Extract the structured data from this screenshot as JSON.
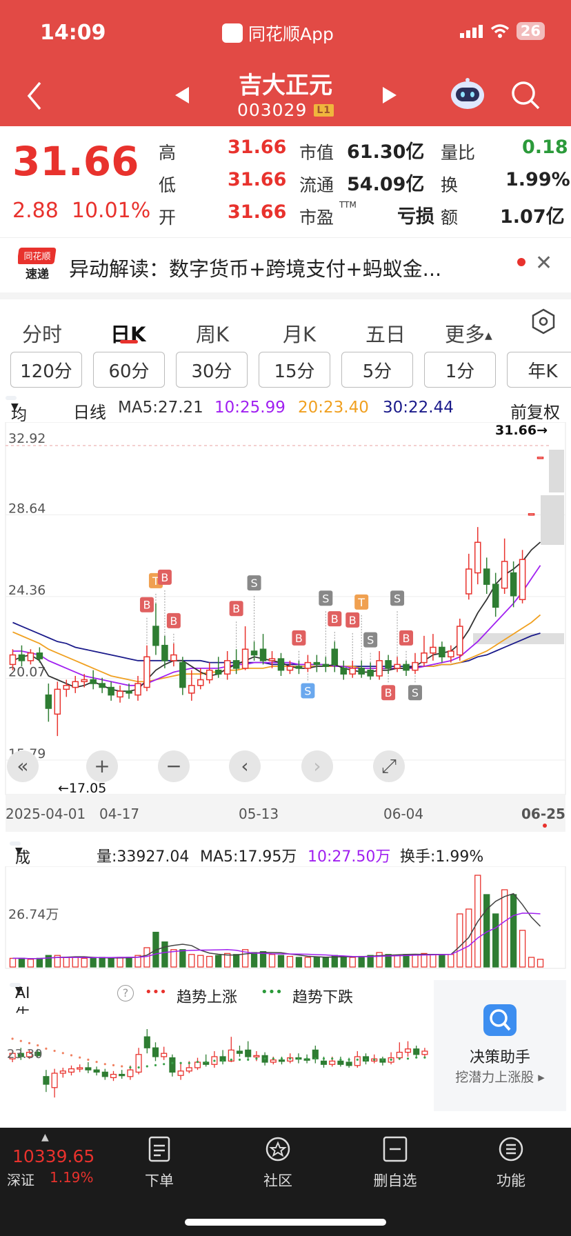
{
  "status": {
    "time": "14:09",
    "app_name": "同花顺App",
    "battery": "26"
  },
  "stock": {
    "name": "吉大正元",
    "code": "003029",
    "tag": "L1"
  },
  "quote": {
    "price": "31.66",
    "change": "2.88",
    "change_pct": "10.01%",
    "high_label": "高",
    "high": "31.66",
    "low_label": "低",
    "low": "31.66",
    "open_label": "开",
    "open": "31.66",
    "mcap_label": "市值",
    "mcap": "61.30亿",
    "float_label": "流通",
    "float": "54.09亿",
    "pe_label": "市盈",
    "pe_sup": "TTM",
    "pe": "亏损",
    "vr_label": "量比",
    "vr": "0.18",
    "turnover_label": "换",
    "turnover": "1.99%",
    "amount_label": "额",
    "amount": "1.07亿"
  },
  "alert": {
    "badge_top": "同花顺",
    "badge_bottom": "速递",
    "text": "异动解读：数字货币+跨境支付+蚂蚁金..."
  },
  "tabs": [
    "分时",
    "日K",
    "周K",
    "月K",
    "五日",
    "更多"
  ],
  "periods": [
    "120分",
    "60分",
    "30分",
    "15分",
    "5分",
    "1分",
    "年K"
  ],
  "ma": {
    "selector": "均线",
    "period": "日线",
    "ma5": "MA5:27.21",
    "ma10": "10:25.99",
    "ma20": "20:23.40",
    "ma30": "30:22.44",
    "adjust": "前复权"
  },
  "colors": {
    "up": "#e8322d",
    "down": "#2e7d32",
    "ma5": "#333333",
    "ma10": "#a020f0",
    "ma20": "#f0a020",
    "ma30": "#1a1a8a"
  },
  "chart_data": {
    "type": "candlestick",
    "y_ticks": [
      "32.92",
      "28.64",
      "24.36",
      "20.07",
      "15.79"
    ],
    "x_ticks": [
      "2025-04-01",
      "04-17",
      "05-13",
      "06-04",
      "06-25"
    ],
    "ylim": [
      15.79,
      32.92
    ],
    "last_price_label": "31.66→",
    "low_label": "←17.05",
    "candles": [
      {
        "o": 20.8,
        "c": 21.3,
        "h": 21.6,
        "l": 20.5
      },
      {
        "o": 21.3,
        "c": 21.0,
        "h": 21.8,
        "l": 20.7
      },
      {
        "o": 21.0,
        "c": 21.4,
        "h": 21.6,
        "l": 20.8
      },
      {
        "o": 21.4,
        "c": 21.1,
        "h": 21.7,
        "l": 20.9
      },
      {
        "o": 19.2,
        "c": 18.5,
        "h": 19.8,
        "l": 17.8
      },
      {
        "o": 18.2,
        "c": 19.5,
        "h": 19.9,
        "l": 17.05
      },
      {
        "o": 19.5,
        "c": 19.7,
        "h": 20.0,
        "l": 19.1
      },
      {
        "o": 19.6,
        "c": 19.9,
        "h": 20.2,
        "l": 19.3
      },
      {
        "o": 19.9,
        "c": 20.0,
        "h": 20.3,
        "l": 19.6
      },
      {
        "o": 20.0,
        "c": 19.8,
        "h": 20.5,
        "l": 19.5
      },
      {
        "o": 19.8,
        "c": 19.6,
        "h": 20.1,
        "l": 19.3
      },
      {
        "o": 19.6,
        "c": 19.2,
        "h": 19.9,
        "l": 18.9
      },
      {
        "o": 19.1,
        "c": 19.4,
        "h": 19.7,
        "l": 18.8
      },
      {
        "o": 19.4,
        "c": 19.3,
        "h": 19.8,
        "l": 19.0
      },
      {
        "o": 19.2,
        "c": 19.8,
        "h": 20.2,
        "l": 18.9
      },
      {
        "o": 19.6,
        "c": 21.2,
        "h": 21.8,
        "l": 19.4
      },
      {
        "o": 22.8,
        "c": 21.8,
        "h": 24.0,
        "l": 21.3
      },
      {
        "o": 21.8,
        "c": 21.0,
        "h": 22.3,
        "l": 20.6
      },
      {
        "o": 21.0,
        "c": 21.3,
        "h": 21.9,
        "l": 20.7
      },
      {
        "o": 20.9,
        "c": 19.6,
        "h": 21.2,
        "l": 19.2
      },
      {
        "o": 19.3,
        "c": 19.7,
        "h": 20.5,
        "l": 18.9
      },
      {
        "o": 19.7,
        "c": 20.0,
        "h": 20.6,
        "l": 19.5
      },
      {
        "o": 20.0,
        "c": 20.5,
        "h": 20.9,
        "l": 19.8
      },
      {
        "o": 20.5,
        "c": 20.3,
        "h": 21.2,
        "l": 20.1
      },
      {
        "o": 20.3,
        "c": 21.0,
        "h": 21.5,
        "l": 20.0
      },
      {
        "o": 21.0,
        "c": 20.6,
        "h": 21.6,
        "l": 20.3
      },
      {
        "o": 20.6,
        "c": 21.6,
        "h": 22.8,
        "l": 20.5
      },
      {
        "o": 21.5,
        "c": 21.3,
        "h": 22.0,
        "l": 21.0
      },
      {
        "o": 21.6,
        "c": 21.0,
        "h": 22.4,
        "l": 20.8
      },
      {
        "o": 21.0,
        "c": 21.1,
        "h": 21.5,
        "l": 20.6
      },
      {
        "o": 21.1,
        "c": 20.5,
        "h": 21.4,
        "l": 20.2
      },
      {
        "o": 20.5,
        "c": 20.7,
        "h": 21.0,
        "l": 20.3
      },
      {
        "o": 20.7,
        "c": 20.6,
        "h": 21.0,
        "l": 20.3
      },
      {
        "o": 20.6,
        "c": 20.9,
        "h": 21.3,
        "l": 20.4
      },
      {
        "o": 20.9,
        "c": 20.8,
        "h": 21.3,
        "l": 20.4
      },
      {
        "o": 20.8,
        "c": 20.7,
        "h": 21.2,
        "l": 20.4
      },
      {
        "o": 21.6,
        "c": 20.8,
        "h": 22.0,
        "l": 20.4
      },
      {
        "o": 20.6,
        "c": 20.3,
        "h": 21.0,
        "l": 20.0
      },
      {
        "o": 20.3,
        "c": 20.6,
        "h": 21.0,
        "l": 20.1
      },
      {
        "o": 20.6,
        "c": 20.3,
        "h": 21.0,
        "l": 20.1
      },
      {
        "o": 20.5,
        "c": 20.2,
        "h": 20.9,
        "l": 20.0
      },
      {
        "o": 20.2,
        "c": 21.0,
        "h": 21.5,
        "l": 20.0
      },
      {
        "o": 21.0,
        "c": 20.6,
        "h": 21.3,
        "l": 20.3
      },
      {
        "o": 20.6,
        "c": 20.8,
        "h": 21.2,
        "l": 20.4
      },
      {
        "o": 20.8,
        "c": 20.5,
        "h": 21.0,
        "l": 20.2
      },
      {
        "o": 20.5,
        "c": 20.9,
        "h": 21.4,
        "l": 20.3
      },
      {
        "o": 20.9,
        "c": 21.4,
        "h": 22.3,
        "l": 20.7
      },
      {
        "o": 21.4,
        "c": 21.7,
        "h": 22.4,
        "l": 21.0
      },
      {
        "o": 21.7,
        "c": 21.2,
        "h": 22.0,
        "l": 20.9
      },
      {
        "o": 21.2,
        "c": 21.5,
        "h": 21.8,
        "l": 20.9
      },
      {
        "o": 21.3,
        "c": 22.8,
        "h": 23.2,
        "l": 21.0
      },
      {
        "o": 24.5,
        "c": 25.8,
        "h": 26.6,
        "l": 24.2
      },
      {
        "o": 25.6,
        "c": 27.2,
        "h": 28.0,
        "l": 25.0
      },
      {
        "o": 25.8,
        "c": 25.0,
        "h": 26.4,
        "l": 24.5
      },
      {
        "o": 25.0,
        "c": 23.8,
        "h": 25.6,
        "l": 23.3
      },
      {
        "o": 24.8,
        "c": 26.2,
        "h": 27.4,
        "l": 24.5
      },
      {
        "o": 25.6,
        "c": 24.4,
        "h": 26.2,
        "l": 23.8
      },
      {
        "o": 24.2,
        "c": 26.3,
        "h": 26.8,
        "l": 24.0
      },
      {
        "o": 28.7,
        "c": 28.7,
        "h": 28.7,
        "l": 28.7
      },
      {
        "o": 31.66,
        "c": 31.66,
        "h": 31.66,
        "l": 31.66
      }
    ],
    "ma5": [
      21.0,
      21.2,
      21.3,
      21.0,
      20.2,
      20.0,
      19.8,
      19.6,
      19.7,
      19.9,
      19.7,
      19.5,
      19.4,
      19.4,
      19.5,
      20.0,
      20.5,
      20.8,
      21.0,
      21.0,
      20.7,
      20.4,
      20.2,
      20.3,
      20.6,
      20.8,
      21.0,
      21.2,
      21.1,
      21.0,
      20.9,
      20.7,
      20.6,
      20.6,
      20.7,
      20.7,
      20.8,
      20.6,
      20.5,
      20.4,
      20.4,
      20.5,
      20.5,
      20.6,
      20.6,
      20.7,
      21.0,
      21.3,
      21.4,
      21.5,
      21.9,
      22.6,
      23.5,
      24.2,
      25.0,
      25.5,
      25.8,
      26.2,
      26.8,
      27.21
    ],
    "ma10": [
      21.5,
      21.5,
      21.4,
      21.3,
      21.0,
      20.8,
      20.6,
      20.4,
      20.2,
      20.1,
      20.0,
      19.9,
      19.8,
      19.7,
      19.7,
      19.8,
      20.0,
      20.2,
      20.4,
      20.5,
      20.6,
      20.6,
      20.6,
      20.6,
      20.7,
      20.8,
      20.8,
      20.9,
      20.9,
      20.9,
      20.9,
      20.9,
      20.8,
      20.8,
      20.8,
      20.8,
      20.7,
      20.7,
      20.6,
      20.6,
      20.6,
      20.6,
      20.6,
      20.6,
      20.6,
      20.6,
      20.7,
      20.8,
      20.9,
      21.0,
      21.2,
      21.6,
      22.0,
      22.5,
      23.0,
      23.5,
      24.0,
      24.6,
      25.3,
      25.99
    ],
    "ma20": [
      22.5,
      22.3,
      22.1,
      21.9,
      21.6,
      21.4,
      21.2,
      21.0,
      20.8,
      20.6,
      20.4,
      20.2,
      20.1,
      20.0,
      19.9,
      19.9,
      20.0,
      20.1,
      20.2,
      20.3,
      20.3,
      20.3,
      20.4,
      20.4,
      20.5,
      20.5,
      20.6,
      20.6,
      20.6,
      20.7,
      20.7,
      20.7,
      20.7,
      20.7,
      20.7,
      20.7,
      20.7,
      20.7,
      20.7,
      20.6,
      20.6,
      20.6,
      20.6,
      20.6,
      20.6,
      20.6,
      20.7,
      20.7,
      20.8,
      20.8,
      20.9,
      21.1,
      21.3,
      21.5,
      21.8,
      22.1,
      22.4,
      22.7,
      23.0,
      23.4
    ],
    "ma30": [
      23.0,
      22.8,
      22.6,
      22.4,
      22.2,
      22.0,
      21.9,
      21.7,
      21.6,
      21.5,
      21.4,
      21.3,
      21.2,
      21.1,
      21.0,
      21.0,
      21.0,
      21.0,
      21.0,
      21.0,
      21.0,
      21.0,
      20.9,
      20.9,
      20.9,
      20.9,
      20.9,
      20.9,
      20.9,
      20.8,
      20.8,
      20.8,
      20.8,
      20.8,
      20.8,
      20.8,
      20.7,
      20.7,
      20.7,
      20.7,
      20.7,
      20.7,
      20.7,
      20.7,
      20.7,
      20.7,
      20.7,
      20.7,
      20.8,
      20.8,
      20.9,
      21.0,
      21.2,
      21.3,
      21.5,
      21.7,
      21.9,
      22.1,
      22.3,
      22.44
    ],
    "signals": [
      {
        "i": 16,
        "type": "T",
        "pos": "above"
      },
      {
        "i": 15,
        "type": "B",
        "pos": "above"
      },
      {
        "i": 17,
        "type": "B",
        "pos": "above"
      },
      {
        "i": 18,
        "type": "B",
        "pos": "above"
      },
      {
        "i": 25,
        "type": "B",
        "pos": "above"
      },
      {
        "i": 27,
        "type": "S",
        "pos": "above"
      },
      {
        "i": 32,
        "type": "B",
        "pos": "above"
      },
      {
        "i": 33,
        "type": "S",
        "pos": "below"
      },
      {
        "i": 35,
        "type": "S",
        "pos": "above"
      },
      {
        "i": 36,
        "type": "B",
        "pos": "above"
      },
      {
        "i": 38,
        "type": "B",
        "pos": "above"
      },
      {
        "i": 39,
        "type": "T",
        "pos": "above"
      },
      {
        "i": 40,
        "type": "S",
        "pos": "above"
      },
      {
        "i": 42,
        "type": "B",
        "pos": "below"
      },
      {
        "i": 43,
        "type": "S",
        "pos": "above"
      },
      {
        "i": 44,
        "type": "B",
        "pos": "above"
      },
      {
        "i": 45,
        "type": "S",
        "pos": "below"
      }
    ]
  },
  "volume": {
    "selector": "成交量",
    "amount": "量:33927.04",
    "ma5": "MA5:17.95万",
    "ma10": "10:27.50万",
    "turnover": "换手:1.99%",
    "tick": "26.74万",
    "bars": [
      0.09,
      0.09,
      0.08,
      0.09,
      0.12,
      0.12,
      0.1,
      0.1,
      0.09,
      0.09,
      0.1,
      0.09,
      0.1,
      0.1,
      0.12,
      0.2,
      0.36,
      0.26,
      0.18,
      0.18,
      0.13,
      0.12,
      0.11,
      0.12,
      0.14,
      0.13,
      0.18,
      0.15,
      0.16,
      0.13,
      0.12,
      0.11,
      0.1,
      0.1,
      0.1,
      0.1,
      0.12,
      0.11,
      0.1,
      0.11,
      0.12,
      0.15,
      0.13,
      0.12,
      0.13,
      0.13,
      0.14,
      0.13,
      0.12,
      0.13,
      0.55,
      0.6,
      0.95,
      0.75,
      0.55,
      0.8,
      0.75,
      0.38,
      0.1,
      0.08
    ]
  },
  "ai": {
    "selector": "AI牛熊线",
    "up_label": "趋势上涨",
    "down_label": "趋势下跌",
    "tick": "23.30"
  },
  "decision": {
    "title": "决策助手",
    "sub": "挖潜力上涨股 ▸"
  },
  "bottom": {
    "index_value": "10339.65",
    "index_name": "深证",
    "index_pct": "1.19%",
    "items": [
      "下单",
      "社区",
      "删自选",
      "功能"
    ]
  }
}
